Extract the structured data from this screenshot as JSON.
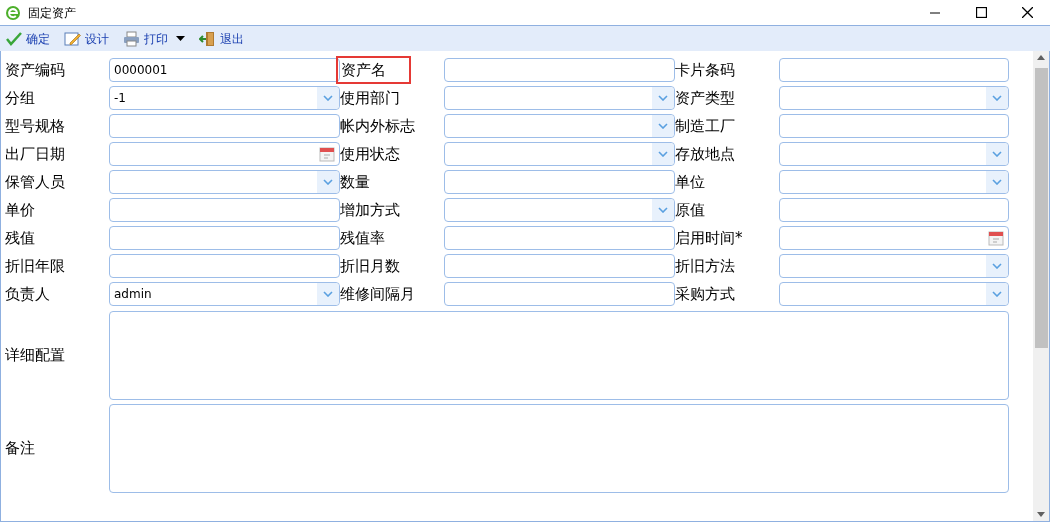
{
  "window": {
    "title": "固定资产"
  },
  "toolbar": [
    {
      "kind": "confirm",
      "label": "确定",
      "dropdown": false
    },
    {
      "kind": "design",
      "label": "设计",
      "dropdown": false
    },
    {
      "kind": "print",
      "label": "打印",
      "dropdown": true
    },
    {
      "kind": "exit",
      "label": "退出",
      "dropdown": false
    }
  ],
  "form": {
    "rows": [
      [
        {
          "label": "资产编码",
          "kind": "text",
          "value": "0000001",
          "highlighted": false
        },
        {
          "label": "资产名",
          "kind": "text",
          "highlighted": true
        },
        {
          "label": "卡片条码",
          "kind": "text",
          "highlighted": false
        }
      ],
      [
        {
          "label": "分组",
          "kind": "select",
          "value": "-1",
          "highlighted": false
        },
        {
          "label": "使用部门",
          "kind": "select",
          "highlighted": false
        },
        {
          "label": "资产类型",
          "kind": "select",
          "highlighted": false
        }
      ],
      [
        {
          "label": "型号规格",
          "kind": "text",
          "highlighted": false
        },
        {
          "label": "帐内外标志",
          "kind": "select",
          "highlighted": false
        },
        {
          "label": "制造工厂",
          "kind": "text",
          "highlighted": false
        }
      ],
      [
        {
          "label": "出厂日期",
          "kind": "date",
          "highlighted": false
        },
        {
          "label": "使用状态",
          "kind": "select",
          "highlighted": false
        },
        {
          "label": "存放地点",
          "kind": "select",
          "highlighted": false
        }
      ],
      [
        {
          "label": "保管人员",
          "kind": "select",
          "highlighted": false
        },
        {
          "label": "数量",
          "kind": "text",
          "highlighted": false
        },
        {
          "label": "单位",
          "kind": "select",
          "highlighted": false
        }
      ],
      [
        {
          "label": "单价",
          "kind": "text",
          "highlighted": false
        },
        {
          "label": "增加方式",
          "kind": "select",
          "highlighted": false
        },
        {
          "label": "原值",
          "kind": "text",
          "highlighted": false
        }
      ],
      [
        {
          "label": "残值",
          "kind": "text",
          "highlighted": false
        },
        {
          "label": "残值率",
          "kind": "text",
          "highlighted": false
        },
        {
          "label": "启用时间*",
          "kind": "date",
          "highlighted": false
        }
      ],
      [
        {
          "label": "折旧年限",
          "kind": "text",
          "highlighted": false
        },
        {
          "label": "折旧月数",
          "kind": "text",
          "highlighted": false
        },
        {
          "label": "折旧方法",
          "kind": "select",
          "highlighted": false
        }
      ],
      [
        {
          "label": "负责人",
          "kind": "select",
          "value": "admin",
          "highlighted": false
        },
        {
          "label": "维修间隔月",
          "kind": "text",
          "highlighted": false
        },
        {
          "label": "采购方式",
          "kind": "select",
          "highlighted": false
        }
      ]
    ],
    "textareas": [
      {
        "label": "详细配置"
      },
      {
        "label": "备注"
      }
    ]
  }
}
